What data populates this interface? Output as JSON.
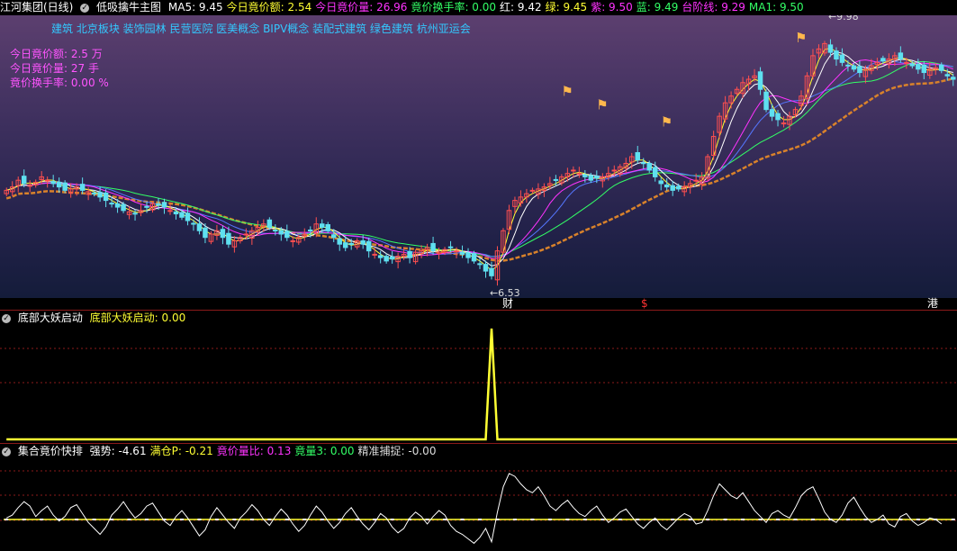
{
  "colors": {
    "up": "#ff4f4f",
    "down": "#5fe0f0",
    "yellow": "#ffff33",
    "magenta": "#ff33ff",
    "green": "#33ff66",
    "blue": "#5577ff",
    "orange": "#d9822b",
    "white": "#ffffff",
    "concept": "#33c8ff",
    "info": "#ff55ff"
  },
  "header_main": {
    "stock": "江河集团(日线)",
    "indicator": "低吸擒牛主图",
    "items": [
      {
        "label": "MA5: ",
        "value": "9.45",
        "color": "#ffffff"
      },
      {
        "label": "今日竟价额: ",
        "value": "2.54",
        "color": "#ffff33"
      },
      {
        "label": "今日竟价量: ",
        "value": "26.96",
        "color": "#ff33ff"
      },
      {
        "label": "竟价换手率: ",
        "value": "0.00",
        "color": "#33ff66"
      },
      {
        "label": "红: ",
        "value": "9.42",
        "color": "#ffffff"
      },
      {
        "label": "绿: ",
        "value": "9.45",
        "color": "#ffff33"
      },
      {
        "label": "紫: ",
        "value": "9.50",
        "color": "#ff33ff"
      },
      {
        "label": "蓝: ",
        "value": "9.49",
        "color": "#33ff66"
      },
      {
        "label": "台阶线: ",
        "value": "9.29",
        "color": "#ff33ff"
      },
      {
        "label": "MA1: ",
        "value": "9.50",
        "color": "#33ff66"
      }
    ]
  },
  "concepts": "建筑 北京板块 装饰园林 民营医院 医美概念 BIPV概念 装配式建筑 绿色建筑 杭州亚运会",
  "info_lines": [
    "今日竟价额:  2.5  万",
    "今日竟价量:  27  手",
    "竟价换手率:  0.00  %"
  ],
  "annotations": {
    "high": "9.98",
    "low": "6.53"
  },
  "tags": [
    {
      "text": "财",
      "color": "#ffffff"
    },
    {
      "text": "$",
      "color": "#ff3333"
    },
    {
      "text": "港",
      "color": "#ffffff"
    }
  ],
  "header_sub1": {
    "name": "底部大妖启动",
    "items": [
      {
        "label": "底部大妖启动: ",
        "value": "0.00",
        "color": "#ffff33"
      }
    ]
  },
  "header_sub2": {
    "name": "集合竟价快排",
    "items": [
      {
        "label": "强势: ",
        "value": "-4.61",
        "color": "#ffffff"
      },
      {
        "label": "满仓P: ",
        "value": "-0.21",
        "color": "#ffff33"
      },
      {
        "label": "竟价量比: ",
        "value": "0.13",
        "color": "#ff33ff"
      },
      {
        "label": "竟量3: ",
        "value": "0.00",
        "color": "#33ff66"
      },
      {
        "label": "精准捕捉: ",
        "value": "-0.00",
        "color": "#dddddd"
      }
    ]
  },
  "chart_data": {
    "type": "candlestick",
    "closes": [
      7.8,
      7.85,
      7.95,
      7.9,
      7.88,
      7.92,
      8.0,
      7.95,
      7.9,
      7.85,
      7.8,
      7.82,
      7.85,
      7.8,
      7.78,
      7.75,
      7.7,
      7.65,
      7.6,
      7.55,
      7.5,
      7.48,
      7.45,
      7.5,
      7.55,
      7.6,
      7.58,
      7.55,
      7.5,
      7.45,
      7.4,
      7.35,
      7.3,
      7.2,
      7.1,
      7.15,
      7.2,
      7.1,
      7.0,
      7.05,
      7.1,
      7.15,
      7.2,
      7.25,
      7.3,
      7.25,
      7.2,
      7.15,
      7.1,
      7.05,
      7.1,
      7.15,
      7.2,
      7.3,
      7.25,
      7.2,
      7.1,
      7.0,
      6.95,
      7.0,
      7.05,
      7.0,
      6.9,
      6.85,
      6.8,
      6.75,
      6.78,
      6.82,
      6.85,
      6.8,
      6.88,
      6.9,
      6.95,
      6.9,
      6.88,
      6.92,
      6.95,
      6.9,
      6.85,
      6.8,
      6.75,
      6.7,
      6.6,
      6.53,
      6.9,
      7.2,
      7.5,
      7.65,
      7.7,
      7.75,
      7.8,
      7.82,
      7.85,
      7.9,
      7.95,
      8.0,
      8.05,
      8.1,
      8.05,
      8.0,
      7.95,
      7.98,
      8.0,
      8.05,
      8.1,
      8.15,
      8.2,
      8.3,
      8.25,
      8.2,
      8.1,
      8.0,
      7.9,
      7.85,
      7.8,
      7.82,
      7.85,
      7.9,
      7.95,
      8.0,
      8.3,
      8.6,
      8.9,
      9.1,
      9.2,
      9.3,
      9.4,
      9.45,
      9.5,
      9.3,
      9.0,
      8.9,
      8.85,
      8.8,
      8.9,
      9.0,
      9.2,
      9.5,
      9.8,
      9.9,
      9.98,
      9.85,
      9.75,
      9.7,
      9.65,
      9.6,
      9.55,
      9.6,
      9.65,
      9.7,
      9.72,
      9.75,
      9.8,
      9.75,
      9.7,
      9.65,
      9.6,
      9.55,
      9.6,
      9.62,
      9.58,
      9.5,
      9.45
    ],
    "ylim": [
      6.2,
      10.4
    ],
    "price_labels": [
      "9.98",
      "6.53"
    ],
    "signals": [
      0,
      0,
      0,
      0,
      0,
      0,
      0,
      0,
      0,
      0,
      0,
      0,
      0,
      0,
      0,
      0,
      0,
      0,
      0,
      0,
      0,
      0,
      0,
      0,
      0,
      0,
      0,
      0,
      0,
      0,
      0,
      0,
      0,
      0,
      0,
      0,
      0,
      0,
      0,
      0,
      0,
      0,
      0,
      0,
      0,
      0,
      0,
      0,
      0,
      0,
      0,
      0,
      0,
      0,
      0,
      0,
      0,
      0,
      0,
      0,
      0,
      0,
      0,
      0,
      0,
      0,
      0,
      0,
      0,
      0,
      0,
      0,
      0,
      0,
      0,
      0,
      0,
      0,
      0,
      0,
      0,
      0,
      0,
      1,
      0,
      0,
      0,
      0,
      0,
      0,
      0,
      0,
      0,
      0,
      0,
      0,
      0,
      0,
      0,
      0,
      0,
      0,
      0,
      0,
      0,
      0,
      0,
      0,
      0,
      0,
      0,
      0,
      0,
      0,
      0,
      0,
      0,
      0,
      0,
      0,
      0,
      0,
      0,
      0,
      0,
      0,
      0,
      0,
      0,
      0,
      0,
      0,
      0,
      0,
      0,
      0,
      0,
      0,
      0,
      0,
      0,
      0,
      0,
      0,
      0,
      0,
      0,
      0,
      0,
      0,
      0,
      0,
      0,
      0,
      0,
      0,
      0,
      0,
      0,
      0,
      0,
      0,
      0,
      0,
      0
    ],
    "osc_white": [
      0.1,
      0.3,
      0.8,
      1.2,
      0.9,
      0.2,
      0.6,
      0.9,
      0.3,
      -0.1,
      0.2,
      0.8,
      1.0,
      0.4,
      -0.2,
      -0.6,
      -1.0,
      -0.5,
      0.3,
      0.7,
      1.2,
      0.6,
      0.1,
      0.4,
      0.9,
      1.1,
      0.5,
      -0.1,
      -0.4,
      0.2,
      0.6,
      0.1,
      -0.5,
      -1.1,
      -0.7,
      0.2,
      0.8,
      0.3,
      -0.2,
      -0.6,
      0.1,
      0.5,
      1.0,
      0.6,
      0.0,
      -0.4,
      0.2,
      0.7,
      0.3,
      -0.3,
      -0.8,
      -0.4,
      0.3,
      0.9,
      0.5,
      -0.1,
      -0.6,
      -0.2,
      0.4,
      0.8,
      0.2,
      -0.3,
      -0.7,
      -0.2,
      0.4,
      0.1,
      -0.5,
      -0.9,
      -0.6,
      0.1,
      0.5,
      0.2,
      -0.3,
      0.2,
      0.6,
      0.3,
      -0.4,
      -0.8,
      -1.0,
      -1.3,
      -1.6,
      -1.2,
      -0.6,
      -1.5,
      0.5,
      2.2,
      3.1,
      2.9,
      2.4,
      2.0,
      1.8,
      2.2,
      1.6,
      0.9,
      0.6,
      1.0,
      1.3,
      0.8,
      0.4,
      0.2,
      0.6,
      0.9,
      0.3,
      -0.2,
      0.1,
      0.5,
      0.7,
      0.2,
      -0.3,
      -0.6,
      -0.2,
      0.1,
      -0.4,
      -0.7,
      -0.3,
      0.1,
      0.4,
      0.2,
      -0.3,
      -0.2,
      0.6,
      1.6,
      2.4,
      2.0,
      1.6,
      1.4,
      1.8,
      1.2,
      0.6,
      0.2,
      -0.2,
      0.4,
      0.6,
      0.3,
      0.1,
      0.8,
      1.6,
      2.0,
      2.2,
      1.4,
      0.5,
      0.0,
      -0.2,
      0.3,
      1.1,
      1.5,
      0.8,
      0.2,
      -0.2,
      0.0,
      0.3,
      -0.3,
      -0.5,
      0.2,
      0.4,
      -0.1,
      -0.4,
      -0.2,
      0.1,
      0.0,
      -0.3
    ],
    "osc_yellow_level": 0.0,
    "osc_ylim": [
      -2.0,
      4.0
    ]
  }
}
